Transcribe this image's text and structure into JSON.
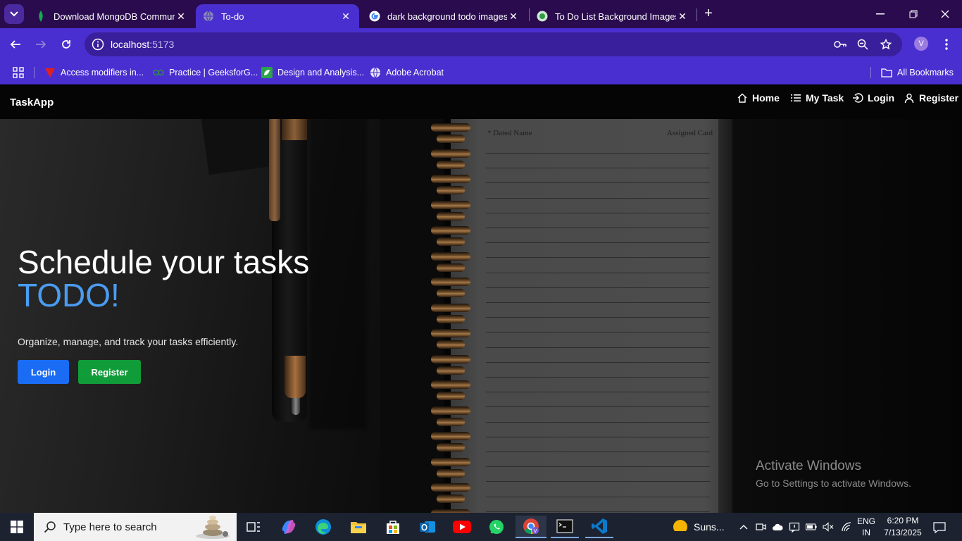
{
  "browser": {
    "tabs": [
      {
        "title": "Download MongoDB Communi",
        "active": false,
        "icon": "mongodb-leaf-icon"
      },
      {
        "title": "To-do",
        "active": true,
        "icon": "globe-icon"
      },
      {
        "title": "dark background todo images a",
        "active": false,
        "icon": "google-icon"
      },
      {
        "title": "To Do List Background Images, ",
        "active": false,
        "icon": "site-favicon-icon"
      }
    ],
    "address": {
      "host": "localhost",
      "port": ":5173"
    },
    "profile_initial": "V",
    "bookmarks": [
      {
        "label": "Access modifiers in...",
        "icon": "red-v-icon"
      },
      {
        "label": "Practice | GeeksforG...",
        "icon": "gfg-icon"
      },
      {
        "label": "Design and Analysis...",
        "icon": "green-leaf-icon"
      },
      {
        "label": "Adobe Acrobat",
        "icon": "globe-icon"
      }
    ],
    "all_bookmarks": "All Bookmarks"
  },
  "app": {
    "brand": "TaskApp",
    "nav": [
      {
        "label": "Home",
        "icon": "home-icon"
      },
      {
        "label": "My Task",
        "icon": "list-icon"
      },
      {
        "label": "Login",
        "icon": "login-icon"
      },
      {
        "label": "Register",
        "icon": "user-icon"
      }
    ],
    "hero": {
      "headline": "Schedule your tasks",
      "headline_accent": "TODO!",
      "subtitle": "Organize, manage, and track your tasks efficiently.",
      "login_label": "Login",
      "register_label": "Register",
      "accent_color": "#4a9cf0"
    },
    "notebook": {
      "left_header": "* Dated Name",
      "right_header": "Assigned Card"
    }
  },
  "watermark": {
    "title": "Activate Windows",
    "subtitle": "Go to Settings to activate Windows."
  },
  "taskbar": {
    "search_placeholder": "Type here to search",
    "weather": "Suns...",
    "language_line1": "ENG",
    "language_line2": "IN",
    "time": "6:20 PM",
    "date": "7/13/2025"
  }
}
